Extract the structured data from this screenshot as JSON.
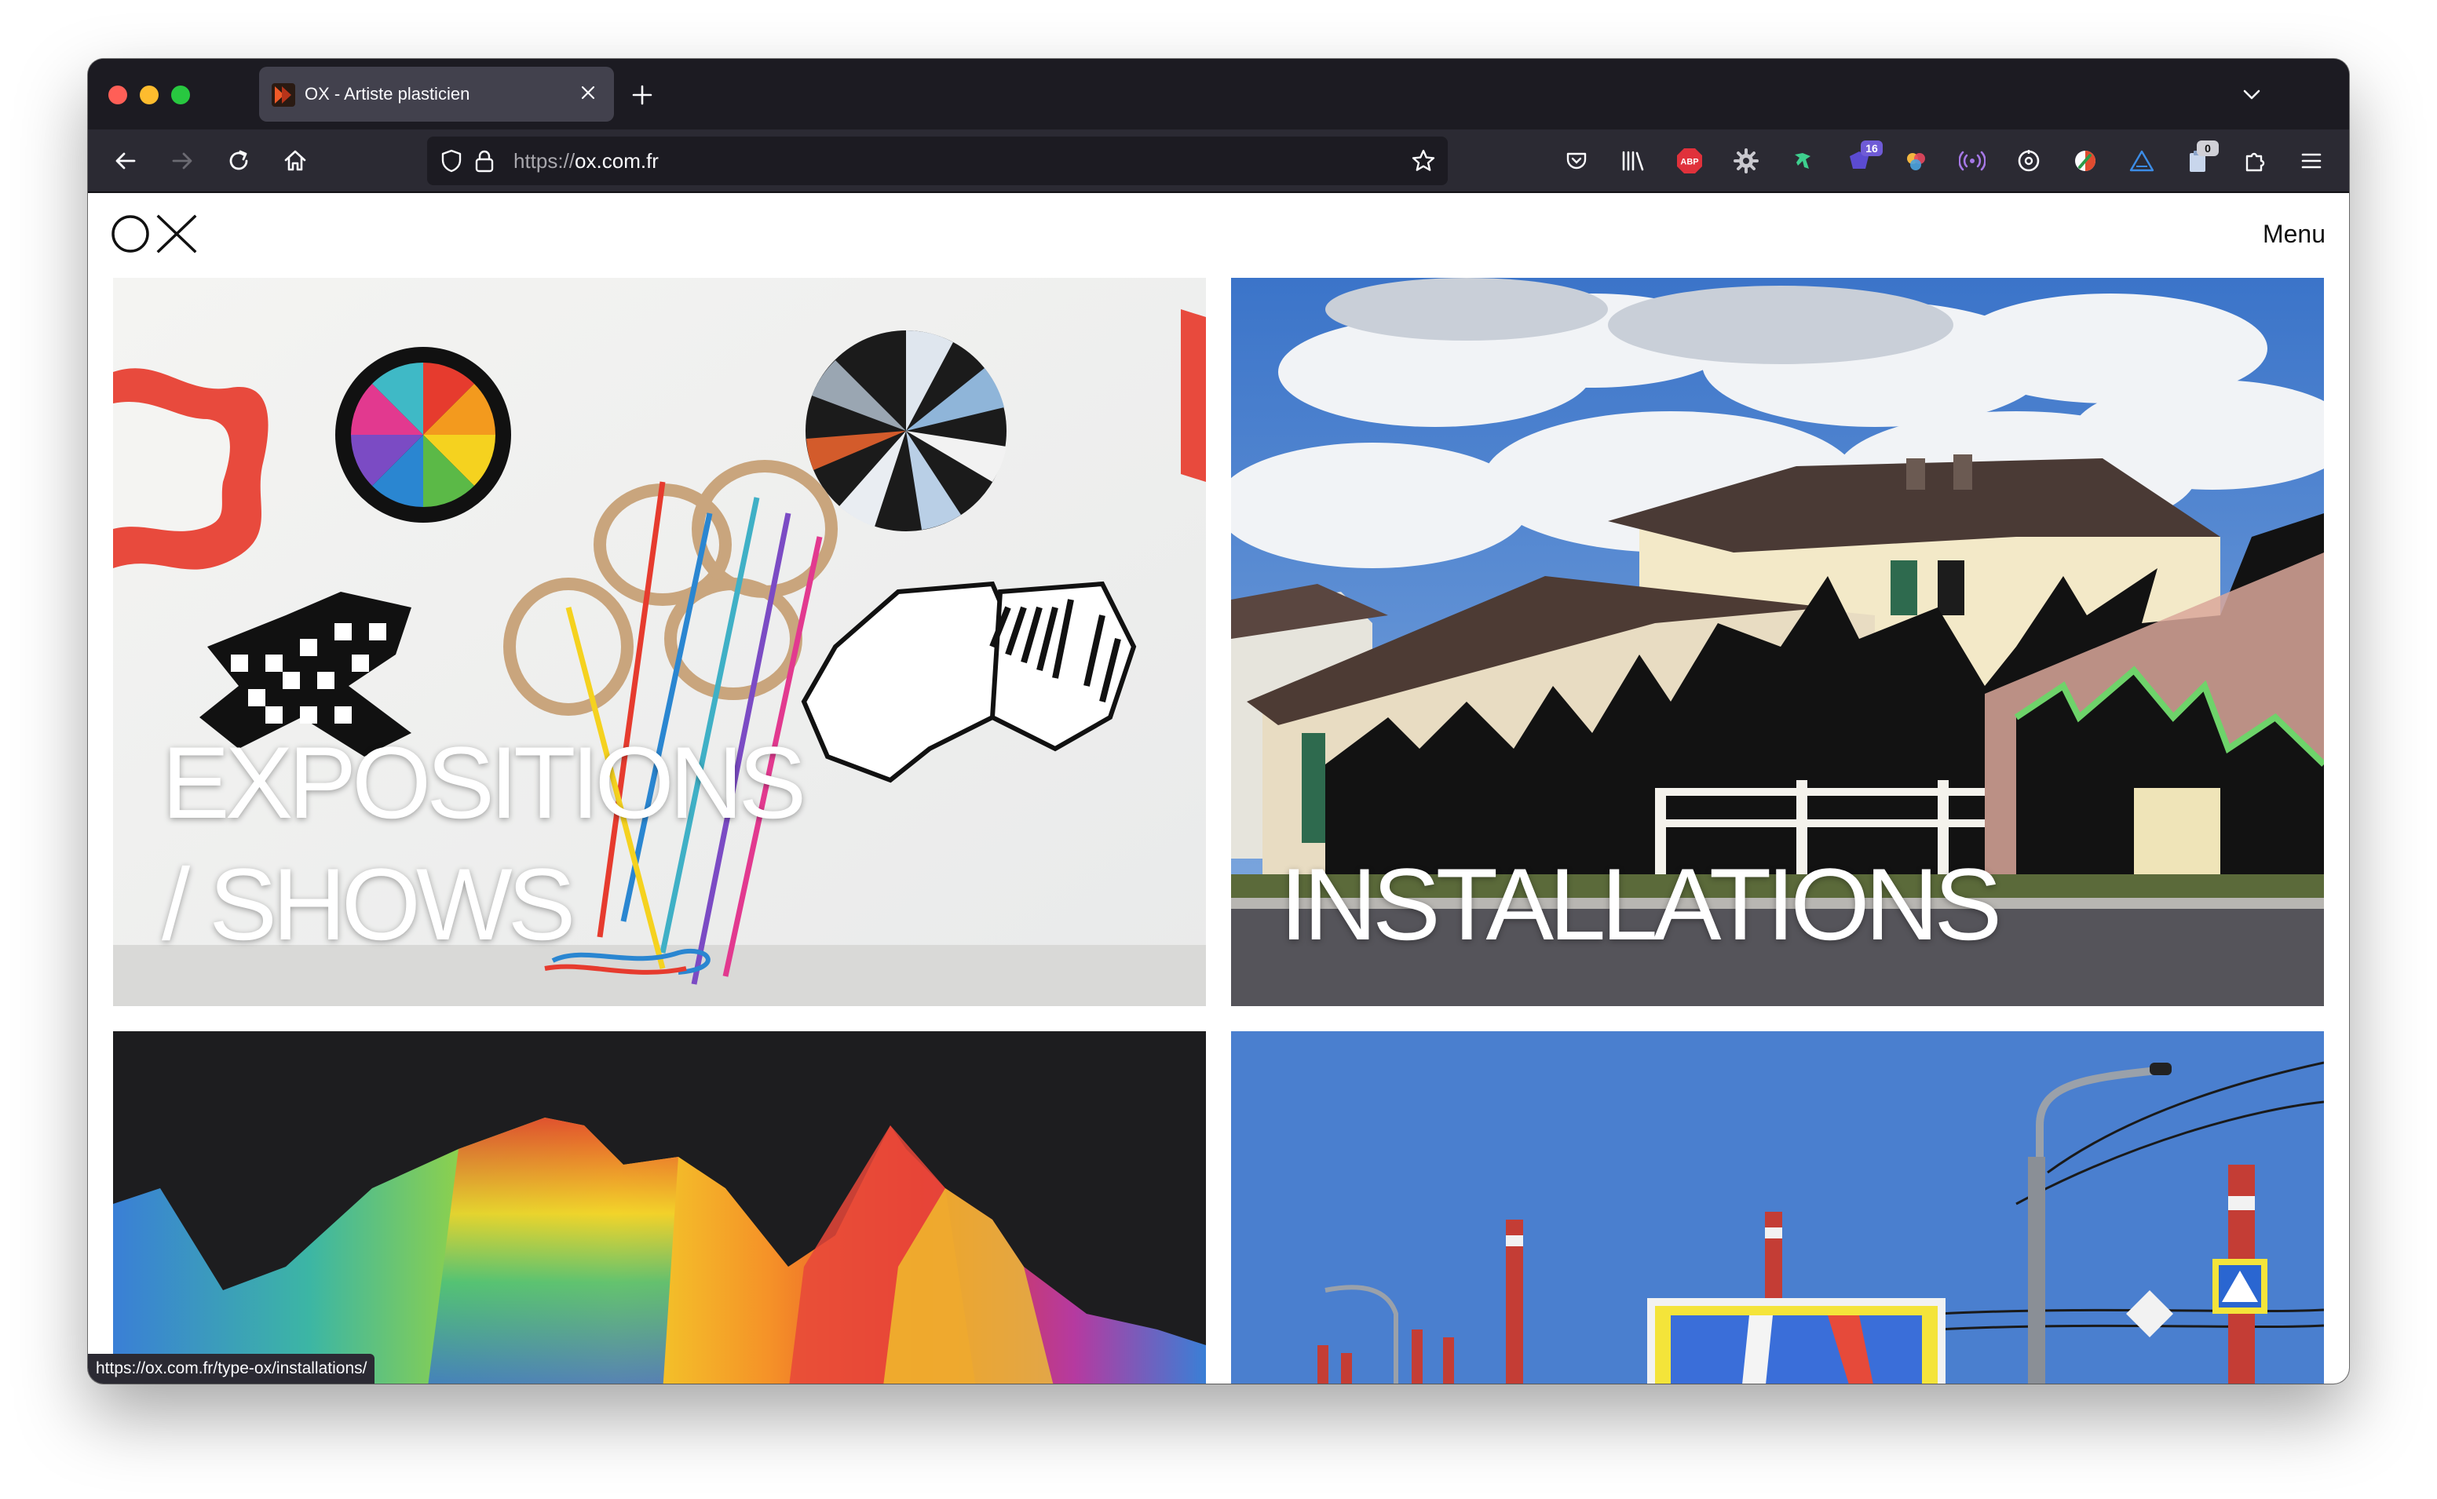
{
  "browser": {
    "tab": {
      "title": "OX - Artiste plasticien"
    },
    "url": {
      "scheme": "https://",
      "host": "ox.com.fr"
    },
    "extensions": {
      "abp_label": "ABP",
      "badge_count_a": "16",
      "badge_count_b": "0"
    },
    "status_url": "https://ox.com.fr/type-ox/installations/"
  },
  "site": {
    "logo_text": "OX",
    "menu_label": "Menu"
  },
  "tiles": [
    {
      "line1": "EXPOSITIONS",
      "line2": "/ SHOWS"
    },
    {
      "label": "INSTALLATIONS"
    },
    {
      "label": ""
    },
    {
      "label": ""
    }
  ],
  "colors": {
    "chrome_dark": "#1c1b22",
    "chrome_nav": "#2b2a33",
    "tab_active": "#42414d",
    "sky_blue": "#4a7fcf"
  }
}
